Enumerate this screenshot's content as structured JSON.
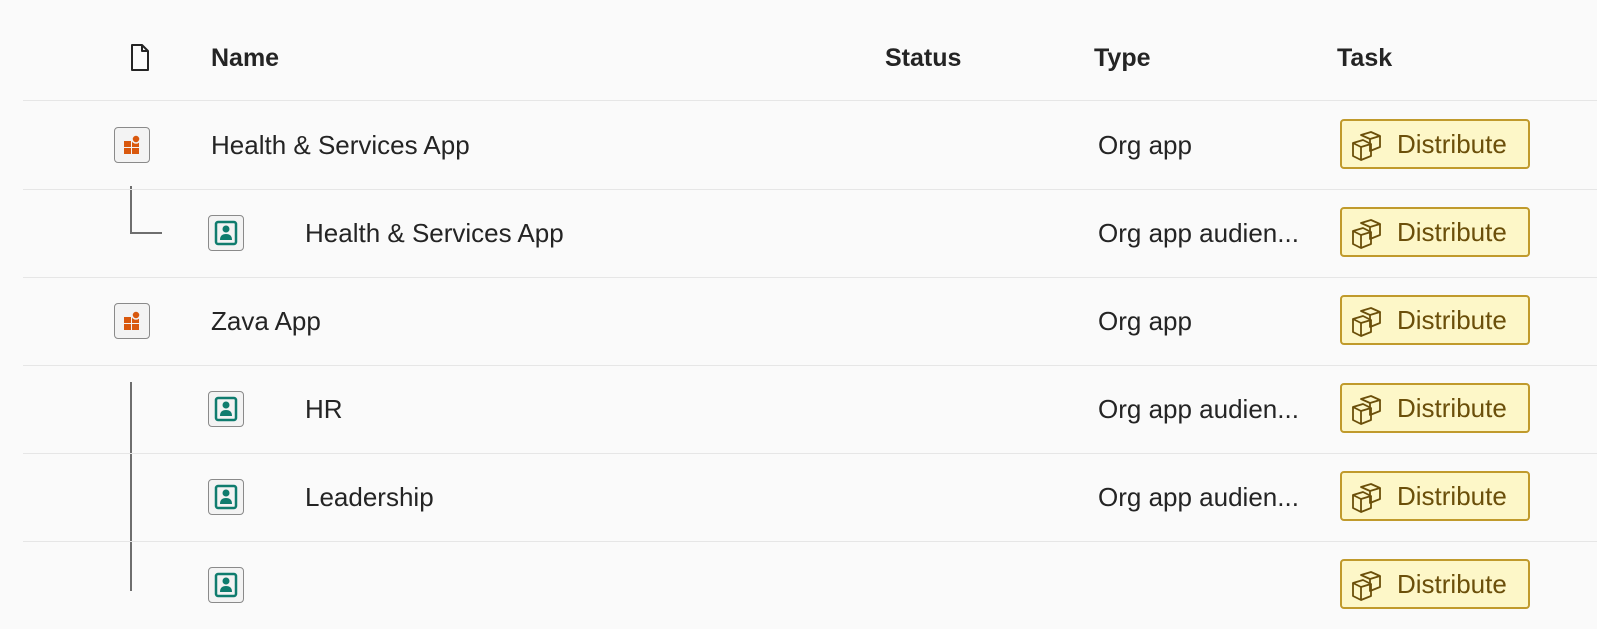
{
  "header": {
    "name": "Name",
    "status": "Status",
    "type": "Type",
    "task": "Task"
  },
  "rows": [
    {
      "name": "Health & Services App",
      "type": "Org app",
      "task": "Distribute",
      "icon": "org-app-icon"
    },
    {
      "name": "Health & Services App",
      "type": "Org app audien...",
      "task": "Distribute",
      "icon": "audience-icon"
    },
    {
      "name": "Zava App",
      "type": "Org app",
      "task": "Distribute",
      "icon": "org-app-icon"
    },
    {
      "name": "HR",
      "type": "Org app audien...",
      "task": "Distribute",
      "icon": "audience-icon"
    },
    {
      "name": "Leadership",
      "type": "Org app audien...",
      "task": "Distribute",
      "icon": "audience-icon"
    },
    {
      "name": "",
      "type": "",
      "task": "Distribute",
      "icon": "audience-icon"
    }
  ],
  "colors": {
    "org_app_accent": "#d9580d",
    "audience_accent": "#0f7c6e",
    "button_bg": "#fdf7c8",
    "button_border": "#c09a2c"
  }
}
